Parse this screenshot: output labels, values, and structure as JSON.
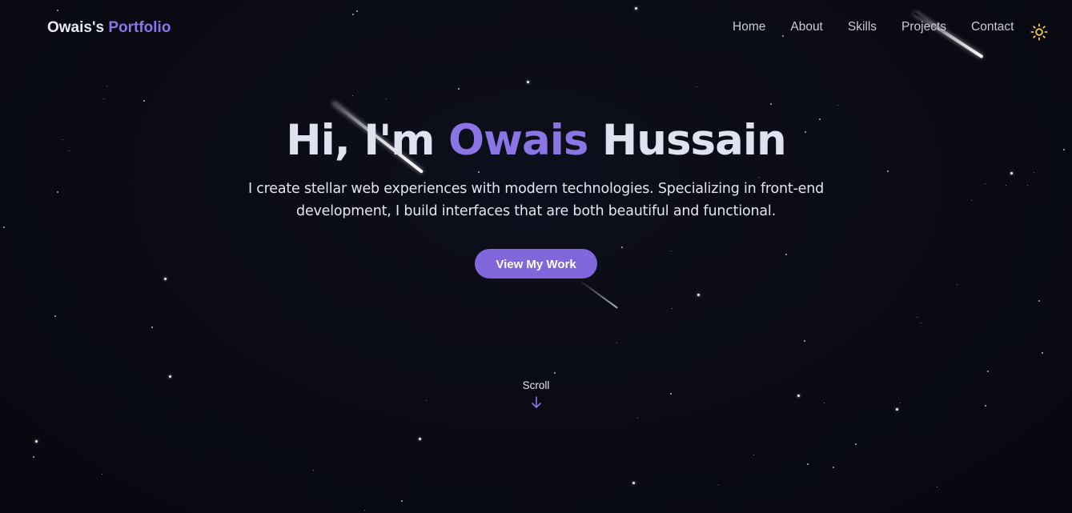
{
  "brand": {
    "owner": "Owais's",
    "highlight": "Portfolio"
  },
  "nav": {
    "items": [
      "Home",
      "About",
      "Skills",
      "Projects",
      "Contact"
    ]
  },
  "theme_toggle": {
    "icon": "sun-icon",
    "color": "#f5c93a"
  },
  "hero": {
    "greeting": "Hi, I'm",
    "first_name": "Owais",
    "last_name": "Hussain",
    "subtitle": "I create stellar web experiences with modern technologies. Specializing in front-end development, I build interfaces that are both beautiful and functional.",
    "cta_label": "View My Work"
  },
  "scroll": {
    "label": "Scroll",
    "icon": "arrow-down-icon"
  },
  "colors": {
    "background": "#0a0b14",
    "accent": "#8b76e6",
    "button": "#8067dc",
    "text": "#dfe2ef"
  }
}
